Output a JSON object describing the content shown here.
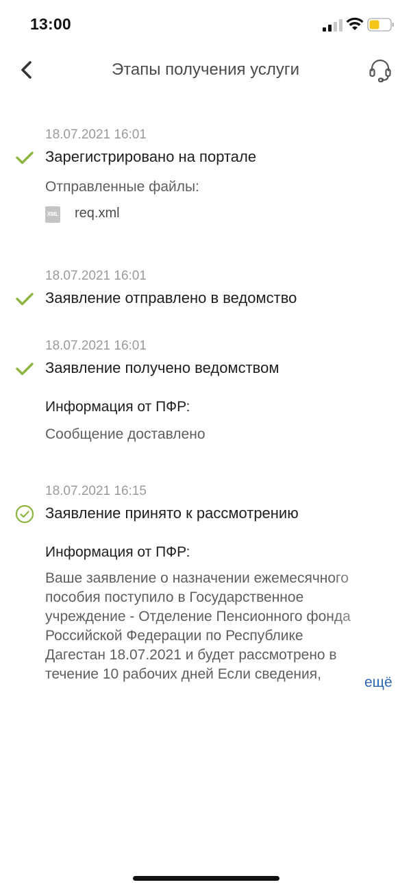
{
  "status_bar": {
    "time": "13:00",
    "battery_color": "#f5c518"
  },
  "header": {
    "title": "Этапы получения услуги",
    "back_icon": "chevron-left-icon",
    "support_icon": "headset-icon"
  },
  "colors": {
    "accent_green": "#8bb53f",
    "link_blue": "#2b67b5"
  },
  "steps": [
    {
      "date": "18.07.2021 16:01",
      "title": "Зарегистрировано на портале",
      "status": "done",
      "sub_label": "Отправленные файлы:",
      "files": [
        {
          "type": "XML",
          "name": "req.xml"
        }
      ]
    },
    {
      "date": "18.07.2021 16:01",
      "title": "Заявление отправлено в ведомство",
      "status": "done"
    },
    {
      "date": "18.07.2021 16:01",
      "title": "Заявление получено ведомством",
      "status": "done",
      "info_label": "Информация от ПФР:",
      "info_text": "Сообщение доставлено"
    },
    {
      "date": "18.07.2021 16:15",
      "title": "Заявление принято к рассмотрению",
      "status": "current",
      "info_label": "Информация от ПФР:",
      "info_lines": [
        "Ваше заявление о назначении ежемесячного",
        "пособия поступило в Государственное",
        "учреждение - Отделение Пенсионного фонда",
        "Российской Федерации по Республике",
        "Дагестан 18.07.2021 и будет рассмотрено в",
        "течение 10 рабочих дней Если сведения,"
      ],
      "more_label": "ещё"
    }
  ]
}
